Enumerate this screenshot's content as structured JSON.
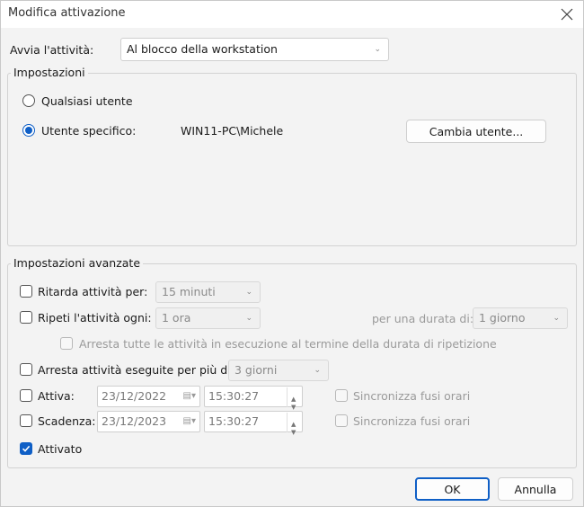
{
  "window": {
    "title": "Modifica attivazione",
    "close_icon": "close-icon"
  },
  "trigger": {
    "label": "Avvia l'attività:",
    "value": "Al blocco della workstation"
  },
  "settings": {
    "legend": "Impostazioni",
    "any_user_label": "Qualsiasi utente",
    "specific_user_label": "Utente specifico:",
    "specific_user_value": "WIN11-PC\\Michele",
    "change_user_button": "Cambia utente...",
    "selected": "specific_user"
  },
  "advanced": {
    "legend": "Impostazioni avanzate",
    "delay": {
      "label": "Ritarda attività per:",
      "value": "15 minuti",
      "checked": false
    },
    "repeat": {
      "label": "Ripeti l'attività ogni:",
      "value": "1 ora",
      "checked": false,
      "duration_label": "per una durata di:",
      "duration_value": "1 giorno"
    },
    "stop_all": {
      "label": "Arresta tutte le attività in esecuzione al termine della durata di ripetizione",
      "checked": false
    },
    "stop_longer": {
      "label": "Arresta attività eseguite per più di:",
      "value": "3 giorni",
      "checked": false
    },
    "activate": {
      "label": "Attiva:",
      "date": "23/12/2022",
      "time": "15:30:27",
      "sync_label": "Sincronizza fusi orari",
      "checked": false
    },
    "expire": {
      "label": "Scadenza:",
      "date": "23/12/2023",
      "time": "15:30:27",
      "sync_label": "Sincronizza fusi orari",
      "checked": false
    },
    "enabled": {
      "label": "Attivato",
      "checked": true
    }
  },
  "buttons": {
    "ok": "OK",
    "cancel": "Annulla"
  },
  "colors": {
    "accent": "#0f5fc6",
    "background": "#f3f3f3"
  }
}
